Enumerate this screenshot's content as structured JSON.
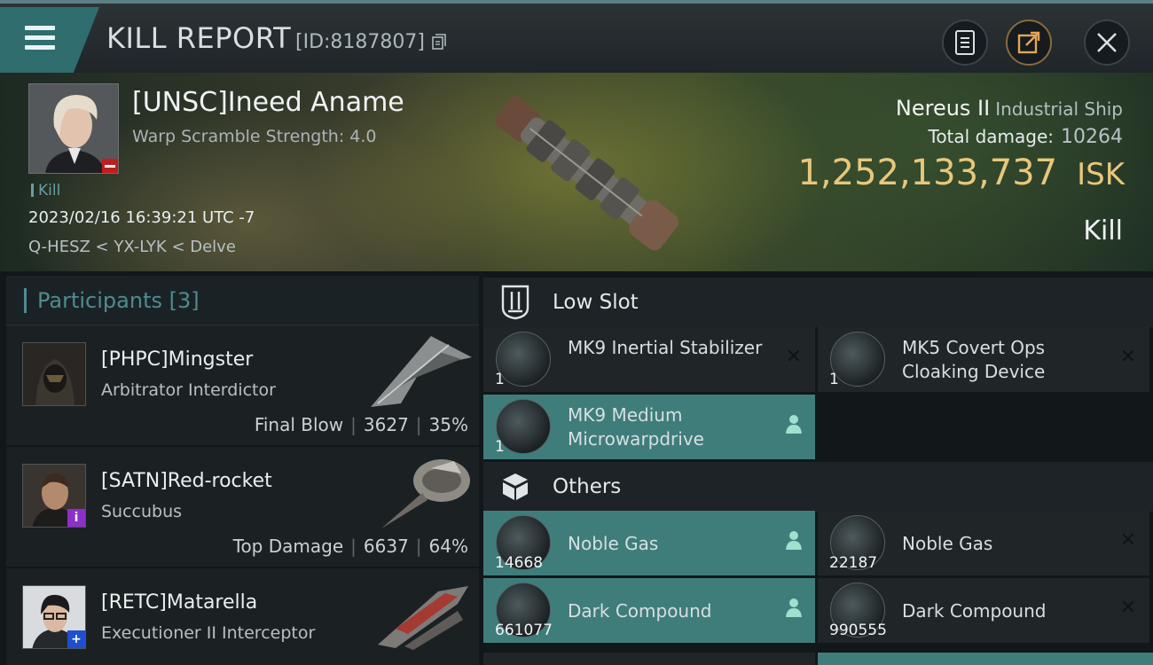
{
  "header": {
    "title": "KILL REPORT",
    "id_text": "[ID:8187807]"
  },
  "victim": {
    "name": "[UNSC]Ineed Aname",
    "warp_scramble": "Warp Scramble Strength: 4.0",
    "type_tag": "Kill",
    "datetime": "2023/02/16 16:39:21 UTC -7",
    "location": "Q-HESZ < YX-LYK < Delve",
    "ship_name": "Nereus II",
    "ship_class": "Industrial Ship",
    "total_damage_label": "Total damage:",
    "total_damage": "10264",
    "isk_value": "1,252,133,737",
    "isk_unit": "ISK",
    "result": "Kill"
  },
  "participants": {
    "label": "Participants",
    "count": "[3]",
    "items": [
      {
        "name": "[PHPC]Mingster",
        "ship": "Arbitrator Interdictor",
        "role": "Final Blow",
        "damage": "3627",
        "percent": "35%"
      },
      {
        "name": "[SATN]Red-rocket",
        "ship": "Succubus",
        "role": "Top Damage",
        "damage": "6637",
        "percent": "64%"
      },
      {
        "name": "[RETC]Matarella",
        "ship": "Executioner II Interceptor",
        "role": "",
        "damage": "",
        "percent": ""
      }
    ]
  },
  "fitting": {
    "low_slot": {
      "title": "Low Slot",
      "items": [
        {
          "name": "MK9 Inertial Stabilizer",
          "qty": "1",
          "state": "destroyed"
        },
        {
          "name": "MK5 Covert Ops Cloaking Device",
          "qty": "1",
          "state": "destroyed"
        },
        {
          "name": "MK9 Medium Microwarpdrive",
          "qty": "1",
          "state": "dropped"
        }
      ]
    },
    "others": {
      "title": "Others",
      "items": [
        {
          "name": "Noble Gas",
          "qty": "14668",
          "state": "dropped"
        },
        {
          "name": "Noble Gas",
          "qty": "22187",
          "state": "destroyed"
        },
        {
          "name": "Dark Compound",
          "qty": "661077",
          "state": "dropped"
        },
        {
          "name": "Dark Compound",
          "qty": "990555",
          "state": "destroyed"
        }
      ]
    }
  },
  "colors": {
    "accent_teal": "#3f7d7b",
    "isk_gold": "#e9c77a",
    "participants_label": "#4d8c91"
  }
}
